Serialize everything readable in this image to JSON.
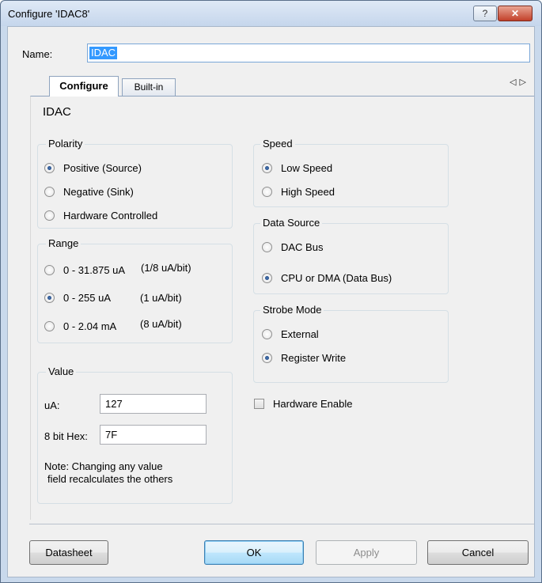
{
  "window": {
    "title": "Configure 'IDAC8'",
    "help_label": "?",
    "close_label": "✕"
  },
  "name_field": {
    "label": "Name:",
    "value": "IDAC"
  },
  "tabs": [
    {
      "label": "Configure",
      "active": true
    },
    {
      "label": "Built-in",
      "active": false
    }
  ],
  "tab_scroll": {
    "left": "◁",
    "right": "▷"
  },
  "section_title": "IDAC",
  "polarity": {
    "title": "Polarity",
    "options": [
      {
        "label": "Positive (Source)",
        "checked": true
      },
      {
        "label": "Negative (Sink)",
        "checked": false
      },
      {
        "label": "Hardware Controlled",
        "checked": false
      }
    ]
  },
  "range": {
    "title": "Range",
    "options": [
      {
        "label": "0 - 31.875 uA",
        "note": "(1/8 uA/bit)",
        "checked": false
      },
      {
        "label": "0 - 255 uA",
        "note": "(1 uA/bit)",
        "checked": true
      },
      {
        "label": "0 - 2.04 mA",
        "note": "(8 uA/bit)",
        "checked": false
      }
    ]
  },
  "value_group": {
    "title": "Value",
    "ua_label": "uA:",
    "ua_value": "127",
    "hex_label": "8 bit Hex:",
    "hex_value": "7F",
    "note_line1": "Note: Changing any value",
    "note_line2": "field recalculates the others"
  },
  "speed": {
    "title": "Speed",
    "options": [
      {
        "label": "Low Speed",
        "checked": true
      },
      {
        "label": "High Speed",
        "checked": false
      }
    ]
  },
  "data_source": {
    "title": "Data Source",
    "options": [
      {
        "label": "DAC Bus",
        "checked": false
      },
      {
        "label": "CPU or DMA (Data Bus)",
        "checked": true
      }
    ]
  },
  "strobe_mode": {
    "title": "Strobe Mode",
    "options": [
      {
        "label": "External",
        "checked": false
      },
      {
        "label": "Register Write",
        "checked": true
      }
    ]
  },
  "hardware_enable": {
    "label": "Hardware Enable",
    "checked": false
  },
  "buttons": {
    "datasheet": "Datasheet",
    "ok": "OK",
    "apply": "Apply",
    "cancel": "Cancel"
  }
}
